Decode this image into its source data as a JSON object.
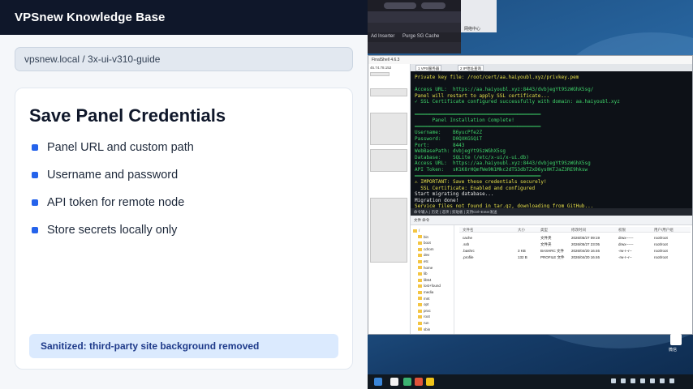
{
  "header": {
    "title": "VPSnew Knowledge Base"
  },
  "breadcrumb": "vpsnew.local / 3x-ui-v310-guide",
  "card": {
    "title": "Save Panel Credentials",
    "bullets": [
      "Panel URL and custom path",
      "Username and password",
      "API token for remote node",
      "Store secrets locally only"
    ],
    "note": "Sanitized: third-party site background removed"
  },
  "screenshot": {
    "bookmarks": [
      "Ad Inserter",
      "Purge SG Cache"
    ],
    "window_title": "FinalShell 4.6.3",
    "tabs": [
      "1 VPS服务器",
      "2 IP地址查询"
    ],
    "sidebar_ip": "45.74.78.152",
    "terminal_lines": [
      {
        "c": "c-y",
        "t": "Private key file: /root/cert/aa.haiyoubl.xyz/privkey.pem"
      },
      {
        "c": "c-g",
        "t": ""
      },
      {
        "c": "c-g",
        "t": "Access URL:  https://aa.haiyoubl.xyz:8443/dvbjegYt9SzWGhX5sg/"
      },
      {
        "c": "c-y",
        "t": "Panel will restart to apply SSL certificate..."
      },
      {
        "c": "c-g",
        "t": "✓ SSL Certificate configured successfully with domain: aa.haiyoubl.xyz"
      },
      {
        "c": "c-g",
        "t": ""
      },
      {
        "c": "c-g",
        "t": "═══════════════════════════════════════════"
      },
      {
        "c": "c-g",
        "t": "      Panel Installation Complete!"
      },
      {
        "c": "c-g",
        "t": "═══════════════════════════════════════════"
      },
      {
        "c": "c-g",
        "t": "Username:    B6yucPfe2Z"
      },
      {
        "c": "c-g",
        "t": "Password:    D0QXKGSQiT"
      },
      {
        "c": "c-g",
        "t": "Port:        8443"
      },
      {
        "c": "c-g",
        "t": "WebBasePath: dvbjegYt9SzWGhX5sg"
      },
      {
        "c": "c-g",
        "t": "Database:    SQLite (/etc/x-ui/x-ui.db)"
      },
      {
        "c": "c-g",
        "t": "Access URL:  https://aa.haiyoubl.xyz:8443/dvbjegYt9SzWGhX5sg"
      },
      {
        "c": "c-g",
        "t": "API Token:   sK1K8rHQmfWe9N1Mkc2dT53dbTZxD6ys0KTJaZ3RE9hksw"
      },
      {
        "c": "c-g",
        "t": "═══════════════════════════════════════════"
      },
      {
        "c": "c-y",
        "t": "⚠ IMPORTANT: Save these credentials securely!"
      },
      {
        "c": "c-y",
        "t": "  SSL Certificate: Enabled and configured"
      },
      {
        "c": "c-w",
        "t": "Start migrating database..."
      },
      {
        "c": "c-w",
        "t": "Migration done!"
      },
      {
        "c": "c-y",
        "t": "Service files not found in tar.gz, downloading from GitHub..."
      }
    ],
    "terminal_status": "命令输入 | 历史 | 选项 | 剪贴板 | 支持Ctrl+Enter发送",
    "fm_toolbar": "文件   命令",
    "fm_tree": [
      "/",
      "bin",
      "boot",
      "cdrom",
      "dev",
      "etc",
      "home",
      "lib",
      "lib64",
      "lost+found",
      "media",
      "mnt",
      "opt",
      "proc",
      "root",
      "run",
      "sbin"
    ],
    "fm_columns": [
      "文件名",
      "大小",
      "类型",
      "修改时间",
      "权限",
      "用户/用户组"
    ],
    "fm_rows": [
      [
        "cache",
        "",
        "文件夹",
        "2026/05/27 09:19",
        "drwx------",
        "root/root"
      ],
      [
        ".ssh",
        "",
        "文件夹",
        "2026/05/27 23:05",
        "drwx------",
        "root/root"
      ],
      [
        ".bashrc",
        "3 KB",
        "BASHRC 文件",
        "2026/04/20 16:46",
        "-rw-r--r--",
        "root/root"
      ],
      [
        ".profile",
        "132 B",
        "PROFILE 文件",
        "2026/04/20 16:46",
        "-rw-r--r--",
        "root/root"
      ]
    ],
    "side_label": "网络中心",
    "tray_label": "微信"
  }
}
